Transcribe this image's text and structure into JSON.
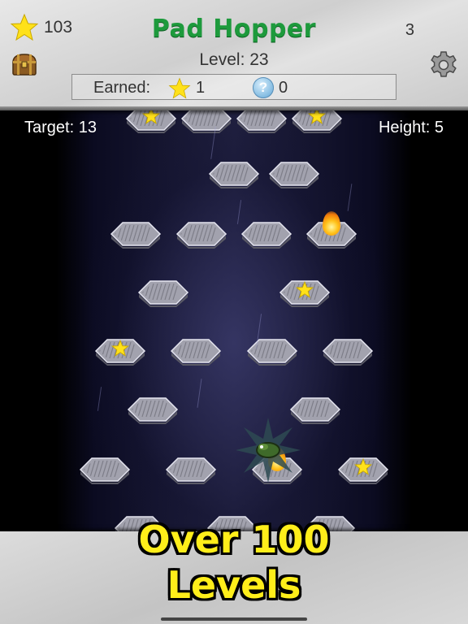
{
  "header": {
    "total_stars": "103",
    "title": "Pad Hopper",
    "right_count": "3",
    "level_label": "Level: 23",
    "earned": {
      "label": "Earned:",
      "stars": "1",
      "hints": "0",
      "hint_glyph": "?"
    },
    "icons": [
      "star-icon",
      "treasure-chest-icon",
      "gear-icon",
      "hint-orb-icon"
    ]
  },
  "hud": {
    "target": "Target: 13",
    "height": "Height: 5"
  },
  "promo": {
    "line1": "Over 100",
    "line2": "Levels"
  },
  "colors": {
    "title_green": "#1d9a3c",
    "star_yellow": "#ffe11a",
    "promo_yellow": "#ffee1a",
    "pad_gray": "#8e8e9a",
    "background": "#000000"
  }
}
